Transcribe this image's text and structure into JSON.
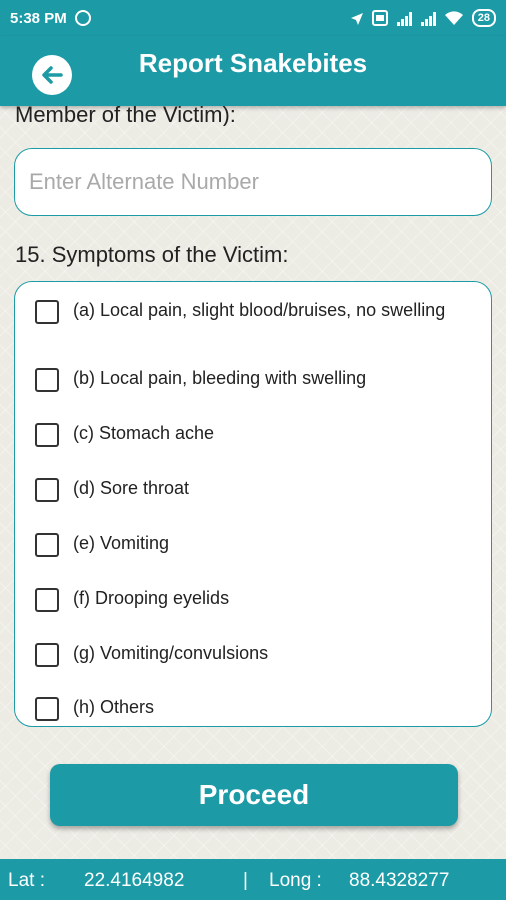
{
  "status_bar": {
    "time": "5:38 PM",
    "battery": "28",
    "icons": [
      "location-icon",
      "volte-icon",
      "signal-icon",
      "signal-icon",
      "wifi-icon",
      "battery-icon"
    ]
  },
  "app_bar": {
    "title": "Report Snakebites",
    "back_icon": "arrow-left-icon"
  },
  "form": {
    "partial_label": "Member of the Victim):",
    "alternate_number": {
      "value": "",
      "placeholder": "Enter Alternate Number"
    },
    "symptoms_label": "15. Symptoms of the Victim:",
    "symptoms": [
      {
        "label": "(a) Local pain, slight blood/bruises, no swelling",
        "checked": false
      },
      {
        "label": "(b) Local pain, bleeding with swelling",
        "checked": false
      },
      {
        "label": "(c) Stomach ache",
        "checked": false
      },
      {
        "label": "(d) Sore throat",
        "checked": false
      },
      {
        "label": "(e) Vomiting",
        "checked": false
      },
      {
        "label": "(f) Drooping eyelids",
        "checked": false
      },
      {
        "label": "(g) Vomiting/convulsions",
        "checked": false
      },
      {
        "label": "(h) Others",
        "checked": false
      }
    ],
    "proceed_label": "Proceed"
  },
  "location": {
    "lat_label": "Lat :",
    "lat_value": "22.4164982",
    "separator": "|",
    "long_label": "Long :",
    "long_value": "88.4328277"
  },
  "colors": {
    "primary": "#1c9ba6",
    "background": "#ecebe4"
  }
}
